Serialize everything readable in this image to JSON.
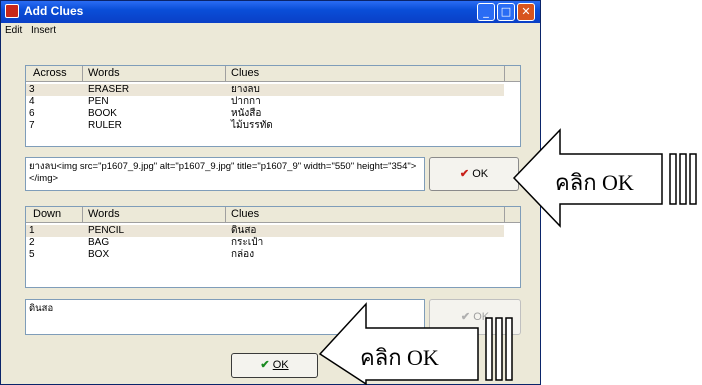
{
  "window": {
    "title": "Add Clues",
    "menu": [
      "Edit",
      "Insert"
    ]
  },
  "across": {
    "columns": [
      "Across",
      "Words",
      "Clues"
    ],
    "rows": [
      {
        "num": "3",
        "word": "ERASER",
        "clue": "ยางลบ"
      },
      {
        "num": "4",
        "word": "PEN",
        "clue": "ปากกา"
      },
      {
        "num": "6",
        "word": "BOOK",
        "clue": "หนังสือ"
      },
      {
        "num": "7",
        "word": "RULER",
        "clue": "ไม้บรรทัด"
      }
    ],
    "memo_text": "ยางลบ<img src=\"p1607_9.jpg\" alt=\"p1607_9.jpg\" title=\"p1607_9\" width=\"550\" height=\"354\"></img>",
    "ok_label": "OK"
  },
  "down": {
    "columns": [
      "Down",
      "Words",
      "Clues"
    ],
    "rows": [
      {
        "num": "1",
        "word": "PENCIL",
        "clue": "ดินสอ"
      },
      {
        "num": "2",
        "word": "BAG",
        "clue": "กระเป๋า"
      },
      {
        "num": "5",
        "word": "BOX",
        "clue": "กล่อง"
      }
    ],
    "memo_text": "ดินสอ",
    "ok_label": "OK"
  },
  "footer": {
    "ok_label": "OK"
  },
  "callouts": {
    "right": "คลิก OK",
    "bottom": "คลิก OK"
  }
}
